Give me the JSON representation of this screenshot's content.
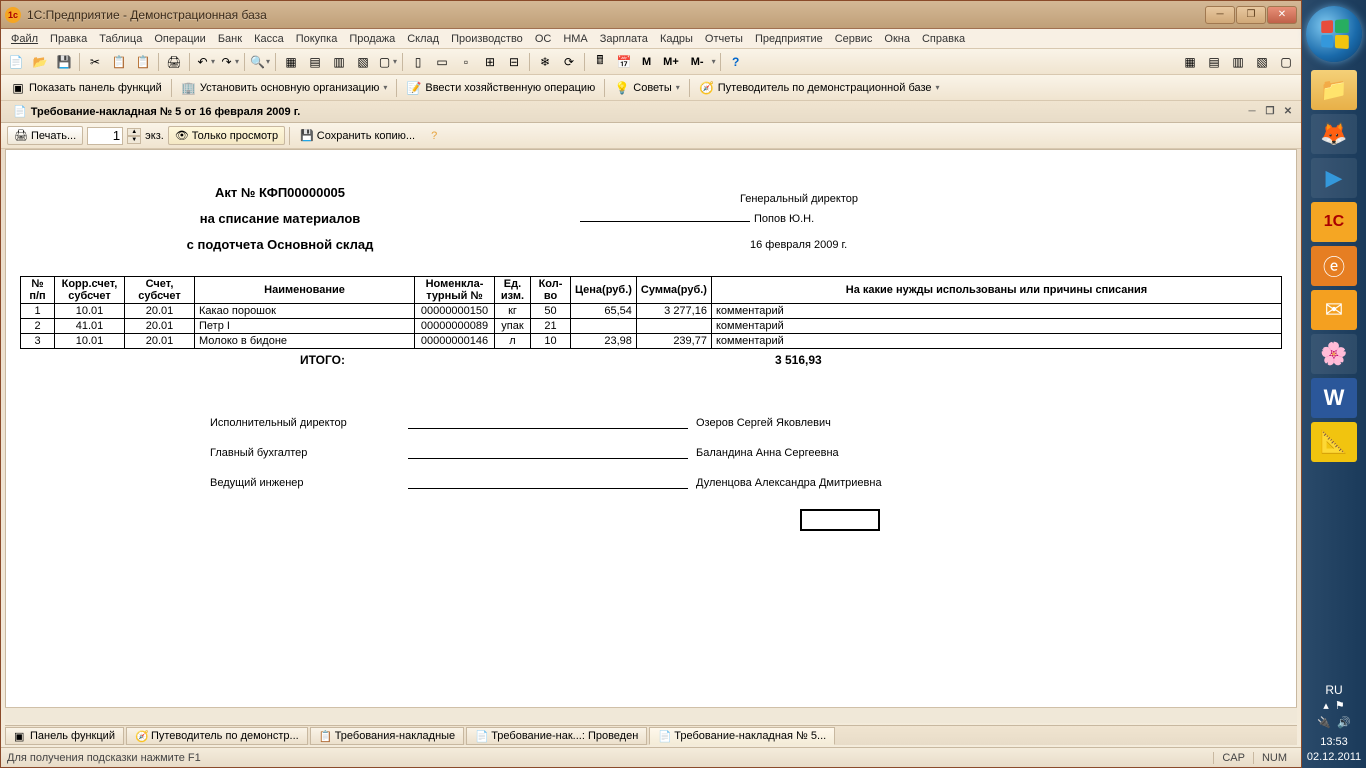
{
  "window": {
    "title": "1С:Предприятие - Демонстрационная база"
  },
  "menu": [
    "Файл",
    "Правка",
    "Таблица",
    "Операции",
    "Банк",
    "Касса",
    "Покупка",
    "Продажа",
    "Склад",
    "Производство",
    "ОС",
    "НМА",
    "Зарплата",
    "Кадры",
    "Отчеты",
    "Предприятие",
    "Сервис",
    "Окна",
    "Справка"
  ],
  "toolbar2": {
    "show_panel": "Показать панель функций",
    "set_org": "Установить основную организацию",
    "enter_op": "Ввести хозяйственную операцию",
    "tips": "Советы",
    "guide": "Путеводитель по демонстрационной базе"
  },
  "doc_tab": "Требование-накладная № 5 от 16 февраля 2009 г.",
  "print_toolbar": {
    "print": "Печать...",
    "copies": "1",
    "copies_suffix": "экз.",
    "view_only": "Только просмотр",
    "save_copy": "Сохранить копию..."
  },
  "mm_labels": {
    "m": "M",
    "mplus": "M+",
    "mminus": "M-"
  },
  "document": {
    "act_title": "Акт № КФП00000005",
    "subtitle1": "на списание материалов",
    "subtitle2": "с подотчета Основной склад",
    "approver_role": "Генеральный директор",
    "approver_name": "Попов Ю.Н.",
    "date": "16 февраля 2009 г.",
    "columns": [
      "№ п/п",
      "Корр.счет, субсчет",
      "Счет, субсчет",
      "Наименование",
      "Номенкла-турный №",
      "Ед. изм.",
      "Кол-во",
      "Цена(руб.)",
      "Сумма(руб.)",
      "На какие нужды использованы или причины списания"
    ],
    "rows": [
      {
        "n": "1",
        "corr": "10.01",
        "acct": "20.01",
        "name": "Какао порошок",
        "nom": "00000000150",
        "unit": "кг",
        "qty": "50",
        "price": "65,54",
        "sum": "3 277,16",
        "reason": "комментарий"
      },
      {
        "n": "2",
        "corr": "41.01",
        "acct": "20.01",
        "name": "Петр I",
        "nom": "00000000089",
        "unit": "упак",
        "qty": "21",
        "price": "",
        "sum": "",
        "reason": "комментарий"
      },
      {
        "n": "3",
        "corr": "10.01",
        "acct": "20.01",
        "name": "Молоко в бидоне",
        "nom": "00000000146",
        "unit": "л",
        "qty": "10",
        "price": "23,98",
        "sum": "239,77",
        "reason": "комментарий"
      }
    ],
    "total_label": "ИТОГО:",
    "total_value": "3 516,93",
    "signatures": [
      {
        "role": "Исполнительный директор",
        "name": "Озеров Сергей Яковлевич"
      },
      {
        "role": "Главный бухгалтер",
        "name": "Баландина Анна Сергеевна"
      },
      {
        "role": "Ведущий инженер",
        "name": "Дуленцова Александра Дмитриевна"
      }
    ]
  },
  "window_tabs": [
    "Панель функций",
    "Путеводитель по демонстр...",
    "Требования-накладные",
    "Требование-нак...: Проведен",
    "Требование-накладная № 5..."
  ],
  "statusbar": {
    "hint": "Для получения подсказки нажмите F1",
    "cap": "CAP",
    "num": "NUM"
  },
  "tray": {
    "lang": "RU",
    "time": "13:53",
    "date": "02.12.2011"
  }
}
